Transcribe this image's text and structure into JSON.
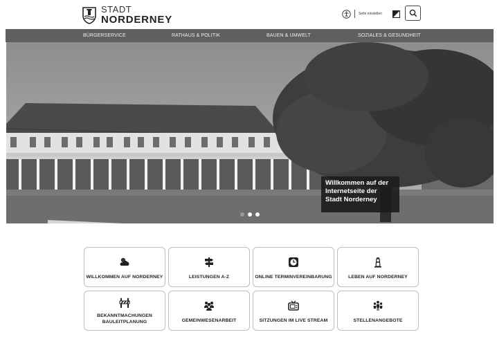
{
  "header": {
    "logo_line1": "STADT",
    "logo_line2": "NORDERNEY",
    "settings_label": "Seite einstellen"
  },
  "nav": {
    "items": [
      {
        "label": "BÜRGERSERVICE"
      },
      {
        "label": "RATHAUS & POLITIK"
      },
      {
        "label": "BAUEN & UMWELT"
      },
      {
        "label": "SOZIALES & GESUNDHEIT"
      }
    ]
  },
  "hero": {
    "caption_lines": [
      "Willkommen auf der",
      "Internetseite der",
      "Stadt Norderney"
    ],
    "slide_count": 3,
    "active_slide": 2
  },
  "tiles": [
    {
      "label": "WILLKOMMEN AUF NORDERNEY",
      "icon": "weather-icon"
    },
    {
      "label": "LEISTUNGEN A-Z",
      "icon": "signpost-icon"
    },
    {
      "label": "ONLINE TERMINVEREINBARUNG",
      "icon": "clock-icon"
    },
    {
      "label": "LEBEN AUF NORDERNEY",
      "icon": "lighthouse-icon"
    },
    {
      "label_lines": [
        "BEKANNTMACHUNGEN",
        "BAULEITPLANUNG"
      ],
      "icon": "construction-barrier-icon"
    },
    {
      "label": "GEMEINWESENARBEIT",
      "icon": "community-icon"
    },
    {
      "label": "SITZUNGEN IM LIVE STREAM",
      "icon": "tv-icon"
    },
    {
      "label": "STELLENANGEBOTE",
      "icon": "people-icon"
    }
  ]
}
